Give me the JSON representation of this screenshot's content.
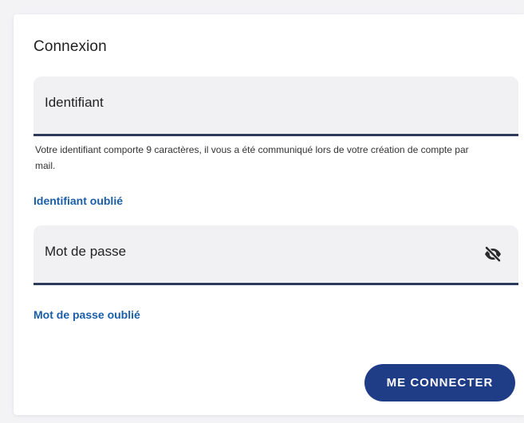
{
  "login": {
    "title": "Connexion",
    "username_field": {
      "label": "Identifiant",
      "help_text": "Votre identifiant comporte 9 caractères, il vous a été communiqué lors de votre création de compte par mail."
    },
    "forgot_username_link": "Identifiant oublié",
    "password_field": {
      "label": "Mot de passe",
      "toggle_icon": "eye-off-icon"
    },
    "forgot_password_link": "Mot de passe oublié",
    "submit_button": "ME CONNECTER"
  },
  "colors": {
    "primary": "#1f3d86",
    "link": "#1a5ea8",
    "field_background": "#f1f1f4",
    "field_border": "#2e3a59"
  }
}
